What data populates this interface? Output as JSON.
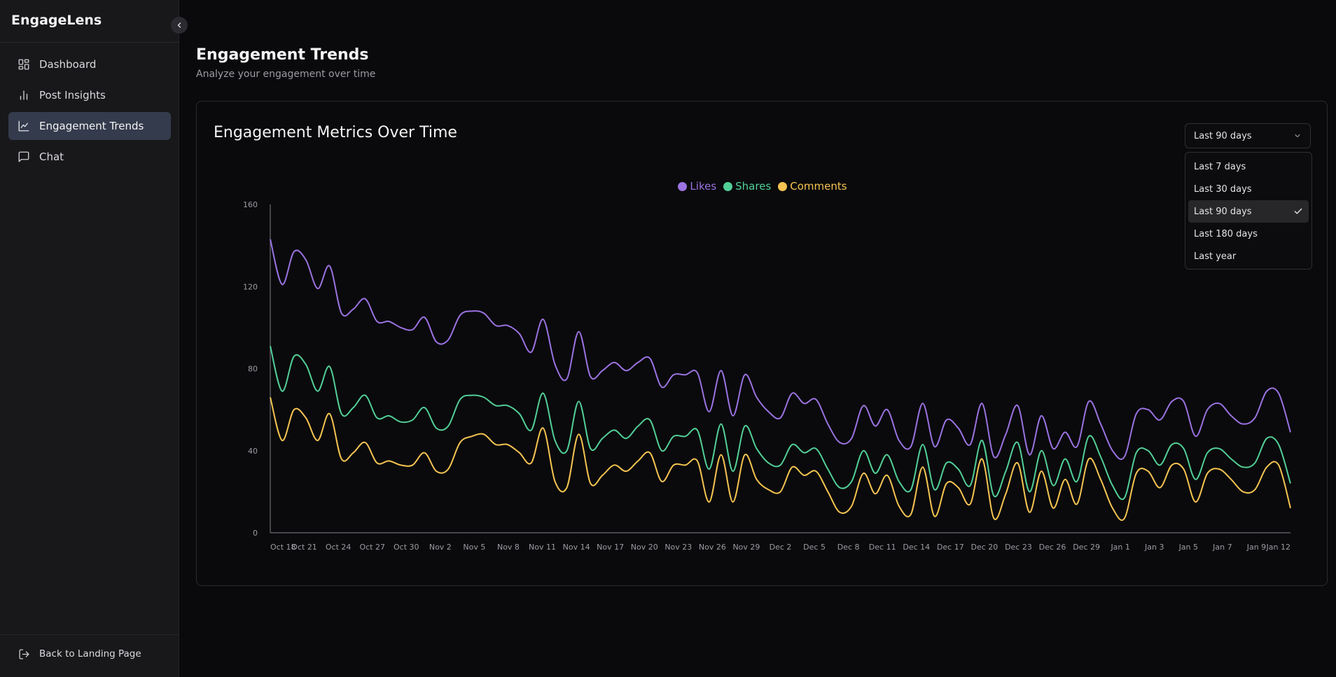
{
  "app": {
    "brand": "EngageLens"
  },
  "sidebar": {
    "items": [
      {
        "label": "Dashboard",
        "icon": "dashboard-icon",
        "active": false
      },
      {
        "label": "Post Insights",
        "icon": "bar-chart-icon",
        "active": false
      },
      {
        "label": "Engagement Trends",
        "icon": "line-chart-icon",
        "active": true
      },
      {
        "label": "Chat",
        "icon": "chat-icon",
        "active": false
      }
    ],
    "back_link": "Back to Landing Page"
  },
  "header": {
    "title": "Engagement Trends",
    "subtitle": "Analyze your engagement over time"
  },
  "card": {
    "title": "Engagement Metrics Over Time",
    "range_select": {
      "value": "Last 90 days",
      "options": [
        "Last 7 days",
        "Last 30 days",
        "Last 90 days",
        "Last 180 days",
        "Last year"
      ],
      "selected_index": 2
    }
  },
  "colors": {
    "likes": "#9b72e0",
    "shares": "#52cf98",
    "comments": "#f5c451",
    "accent_active": "#343b4c"
  },
  "chart_data": {
    "type": "line",
    "x_tick_labels": [
      "Oct 18",
      "Oct 21",
      "Oct 24",
      "Oct 27",
      "Oct 30",
      "Nov 2",
      "Nov 5",
      "Nov 8",
      "Nov 11",
      "Nov 14",
      "Nov 17",
      "Nov 20",
      "Nov 23",
      "Nov 26",
      "Nov 29",
      "Dec 2",
      "Dec 5",
      "Dec 8",
      "Dec 11",
      "Dec 14",
      "Dec 17",
      "Dec 20",
      "Dec 23",
      "Dec 26",
      "Dec 29",
      "Jan 1",
      "Jan 3",
      "Jan 5",
      "Jan 7",
      "Jan 9",
      "Jan 12"
    ],
    "y_ticks": [
      0,
      40,
      80,
      120,
      160
    ],
    "ylim": [
      0,
      160
    ],
    "legend_position": "top-center",
    "grid": false,
    "series": [
      {
        "name": "Likes",
        "color": "#9b72e0",
        "values": [
          143,
          121,
          137,
          133,
          119,
          130,
          107,
          109,
          114,
          103,
          103,
          100,
          99,
          105,
          93,
          94,
          106,
          108,
          107,
          101,
          101,
          97,
          88,
          104,
          82,
          75,
          98,
          76,
          79,
          83,
          79,
          83,
          85,
          71,
          77,
          77,
          78,
          59,
          79,
          57,
          77,
          66,
          59,
          56,
          68,
          63,
          65,
          53,
          44,
          46,
          62,
          52,
          60,
          45,
          42,
          63,
          42,
          55,
          51,
          43,
          63,
          37,
          48,
          62,
          38,
          57,
          41,
          49,
          42,
          64,
          53,
          40,
          37,
          58,
          60,
          55,
          64,
          64,
          47,
          60,
          63,
          57,
          53,
          56,
          69,
          68,
          49
        ]
      },
      {
        "name": "Shares",
        "color": "#52cf98",
        "values": [
          91,
          69,
          86,
          82,
          69,
          81,
          58,
          61,
          67,
          56,
          57,
          54,
          55,
          61,
          51,
          52,
          65,
          67,
          66,
          62,
          62,
          58,
          50,
          68,
          45,
          40,
          64,
          41,
          46,
          50,
          46,
          52,
          55,
          40,
          47,
          47,
          50,
          31,
          53,
          30,
          52,
          41,
          34,
          33,
          43,
          39,
          41,
          31,
          22,
          25,
          40,
          29,
          38,
          25,
          21,
          43,
          21,
          34,
          31,
          23,
          45,
          18,
          30,
          44,
          20,
          40,
          23,
          36,
          25,
          47,
          37,
          23,
          17,
          39,
          40,
          33,
          43,
          41,
          26,
          39,
          41,
          36,
          32,
          34,
          46,
          43,
          24
        ]
      },
      {
        "name": "Comments",
        "color": "#f5c451",
        "values": [
          66,
          45,
          60,
          56,
          45,
          58,
          36,
          39,
          44,
          34,
          35,
          33,
          33,
          39,
          30,
          31,
          44,
          47,
          48,
          43,
          43,
          39,
          34,
          51,
          25,
          22,
          48,
          24,
          28,
          33,
          30,
          35,
          39,
          25,
          33,
          33,
          35,
          15,
          38,
          15,
          38,
          26,
          21,
          20,
          32,
          28,
          30,
          20,
          10,
          13,
          29,
          19,
          28,
          13,
          9,
          32,
          8,
          24,
          22,
          14,
          36,
          7,
          19,
          34,
          10,
          30,
          12,
          26,
          14,
          36,
          26,
          12,
          7,
          29,
          30,
          22,
          33,
          31,
          15,
          29,
          31,
          26,
          20,
          21,
          32,
          33,
          12
        ]
      }
    ]
  }
}
